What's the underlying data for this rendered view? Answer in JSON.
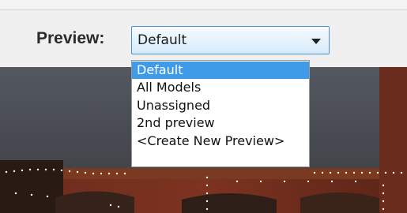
{
  "preview": {
    "label": "Preview:",
    "selected": "Default",
    "options": [
      "Default",
      "All Models",
      "Unassigned",
      "2nd preview",
      "<Create New Preview>"
    ],
    "highlighted_index": 0
  },
  "colors": {
    "highlight": "#3f9be8",
    "combo_border": "#4e90cc"
  }
}
